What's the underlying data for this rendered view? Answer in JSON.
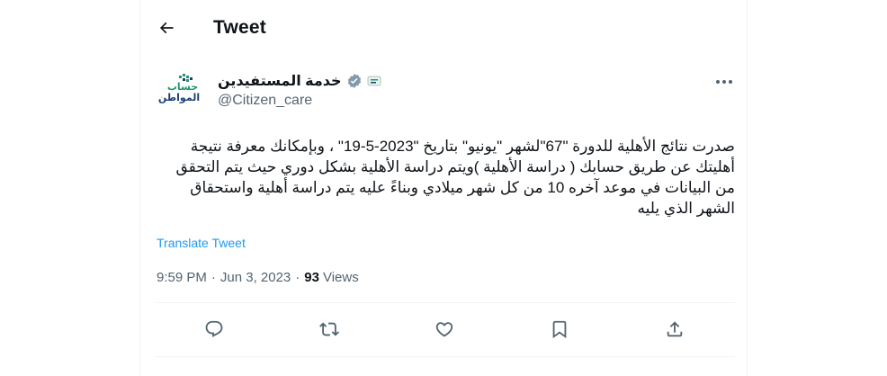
{
  "header": {
    "title": "Tweet",
    "back_icon": "arrow-left-icon"
  },
  "author": {
    "avatar_text_line1": "حساب",
    "avatar_text_line2": "المواطن",
    "display_name": "خدمة المستفيدين",
    "handle": "@Citizen_care",
    "verified_badge_icon": "gray-verified-badge-icon",
    "affiliate_badge_icon": "affiliate-badge-icon"
  },
  "tweet": {
    "text": "صدرت نتائج الأهلية للدورة \"67\"لشهر \"يونيو\" بتاريخ \"2023-5-19\" ، وبإمكانك معرفة نتيجة أهليتك عن طريق حسابك ( دراسة الأهلية )ويتم دراسة الأهلية بشكل دوري حيث يتم التحقق من البيانات في موعد آخره 10 من كل شهر ميلادي وبناءً عليه يتم دراسة أهلية واستحقاق الشهر الذي يليه",
    "translate_label": "Translate Tweet",
    "time": "9:59 PM",
    "separator": "·",
    "date": "Jun 3, 2023",
    "views_count": "93",
    "views_label": "Views"
  },
  "actions": [
    {
      "icon": "reply-icon"
    },
    {
      "icon": "retweet-icon"
    },
    {
      "icon": "like-icon"
    },
    {
      "icon": "bookmark-icon"
    },
    {
      "icon": "share-icon"
    }
  ],
  "colors": {
    "accent": "#1d9bf0",
    "text_primary": "#0f1419",
    "text_secondary": "#536471",
    "divider": "#eff3f4",
    "avatar_green": "#1f9a6b",
    "avatar_navy": "#1b3f74"
  }
}
